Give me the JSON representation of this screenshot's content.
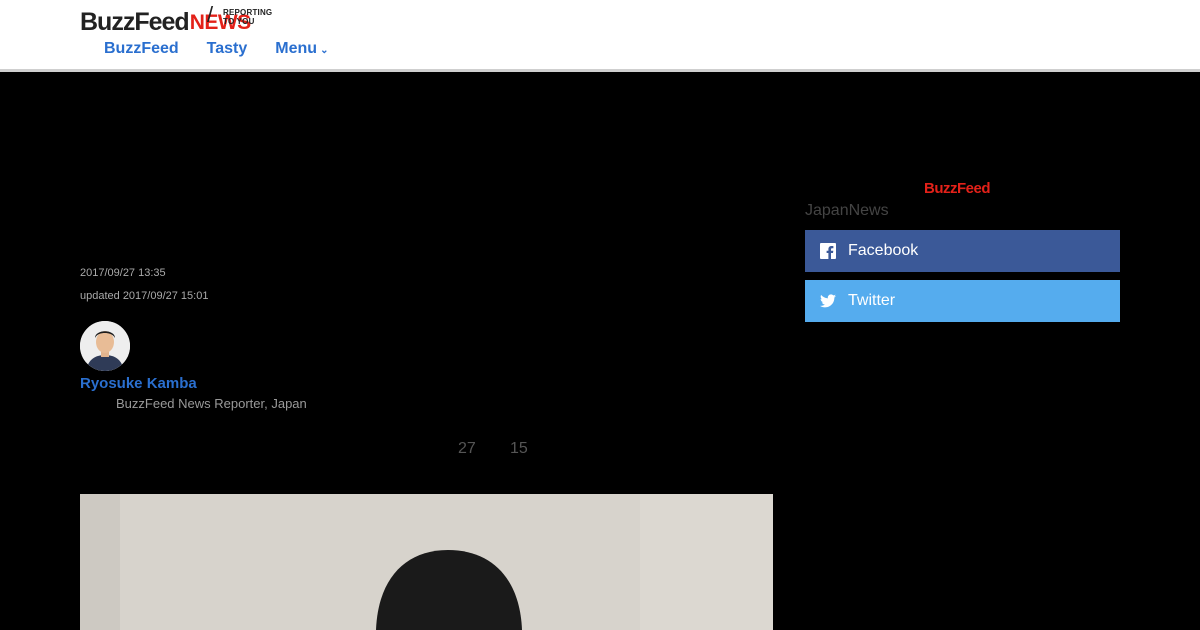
{
  "header": {
    "logo": {
      "brand": "BuzzFeed",
      "news": "NEWS",
      "slash": "/",
      "tagline": "REPORTING TO YOU"
    },
    "nav": [
      {
        "label": "BuzzFeed"
      },
      {
        "label": "Tasty"
      },
      {
        "label": "Menu",
        "icon": "chevron-down-icon"
      }
    ]
  },
  "article": {
    "published": "2017/09/27 13:35",
    "updated": "updated 2017/09/27 15:01",
    "author": {
      "name": "Ryosuke Kamba",
      "title": "BuzzFeed News Reporter, Japan"
    },
    "counts": [
      "27",
      "15"
    ]
  },
  "sidebar": {
    "brand": "BuzzFeed",
    "label": "JapanNews",
    "share": [
      {
        "label": "Facebook",
        "icon": "facebook-icon",
        "color": "#3b5998"
      },
      {
        "label": "Twitter",
        "icon": "twitter-icon",
        "color": "#55acee"
      }
    ]
  },
  "colors": {
    "accent": "#2a6fcf",
    "brand_red": "#e32119",
    "background": "#000000"
  }
}
